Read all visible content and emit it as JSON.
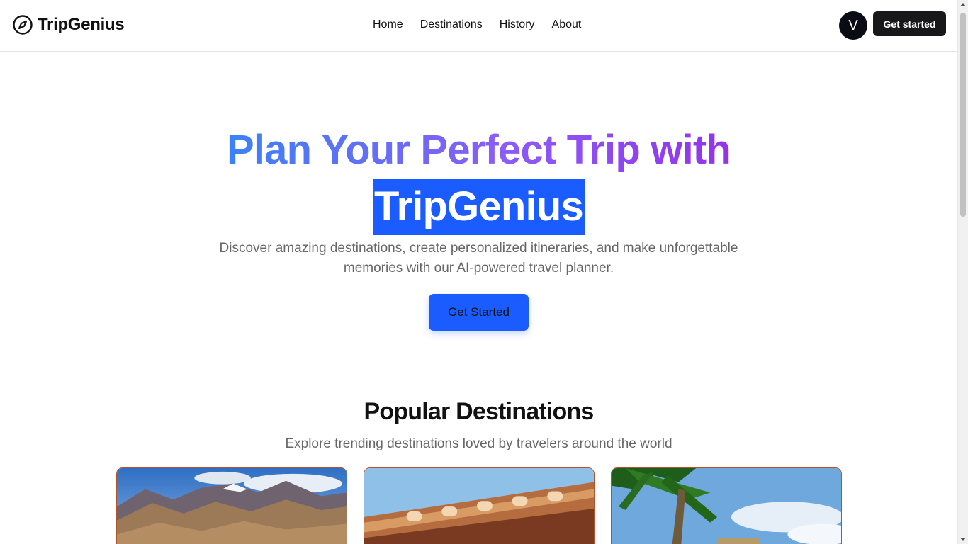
{
  "brand": {
    "name": "TripGenius"
  },
  "nav": {
    "items": [
      "Home",
      "Destinations",
      "History",
      "About"
    ]
  },
  "header": {
    "avatar_initial": "V",
    "cta_label": "Get started"
  },
  "hero": {
    "title_line1": "Plan Your Perfect Trip with",
    "title_highlight": "TripGenius",
    "subtitle": "Discover amazing destinations, create personalized itineraries, and make unforgettable memories with our AI-powered travel planner.",
    "cta_label": "Get Started"
  },
  "popular": {
    "title": "Popular Destinations",
    "subtitle": "Explore trending destinations loved by travelers around the world"
  },
  "colors": {
    "accent": "#1a5cff",
    "gradient_start": "#3b82f6",
    "gradient_end": "#9333ea",
    "dark": "#18181b"
  },
  "icons": {
    "logo": "compass-icon"
  }
}
